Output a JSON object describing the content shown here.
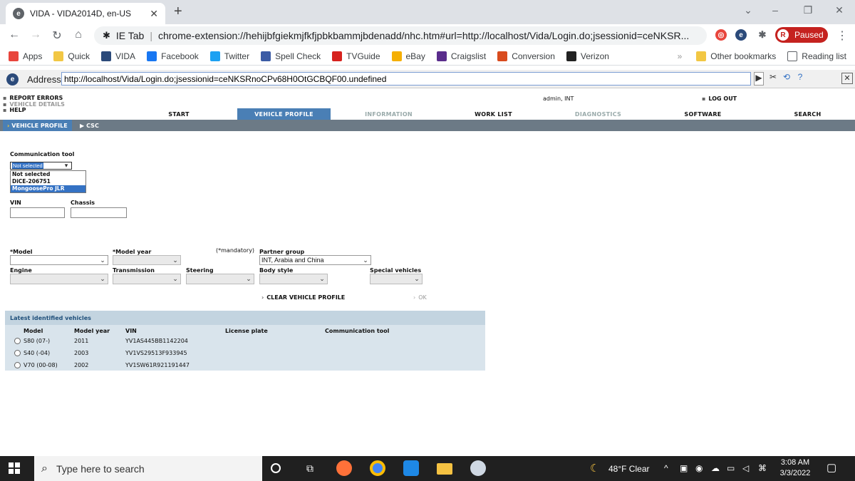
{
  "browser": {
    "tab_title": "VIDA - VIDA2014D, en-US",
    "tab_close": "✕",
    "new_tab": "+",
    "url_prefix": "IE Tab",
    "url": "chrome-extension://hehijbfgiekmjfkfjpbkbammjbdenadd/nhc.htm#url=http://localhost/Vida/Login.do;jsessionid=ceNKSR...",
    "profile_status": "Paused",
    "profile_initial": "R"
  },
  "bookmarks": {
    "items": [
      {
        "label": "Apps",
        "icon": "apps-grid-icon",
        "color": "#e8453c"
      },
      {
        "label": "Quick",
        "icon": "folder-icon",
        "color": "#f2c744"
      },
      {
        "label": "VIDA",
        "icon": "ie-tab-icon",
        "color": "#2b4a7a"
      },
      {
        "label": "Facebook",
        "icon": "facebook-icon",
        "color": "#1877f2"
      },
      {
        "label": "Twitter",
        "icon": "twitter-icon",
        "color": "#1da1f2"
      },
      {
        "label": "Spell Check",
        "icon": "shield-check-icon",
        "color": "#3b5ba5"
      },
      {
        "label": "TVGuide",
        "icon": "tvguide-icon",
        "color": "#d6221e"
      },
      {
        "label": "eBay",
        "icon": "shopping-bag-icon",
        "color": "#f5af02"
      },
      {
        "label": "Craigslist",
        "icon": "peace-icon",
        "color": "#5a2d8c"
      },
      {
        "label": "Conversion",
        "icon": "conversion-icon",
        "color": "#d94b1e"
      },
      {
        "label": "Verizon",
        "icon": "verizon-icon",
        "color": "#222222"
      }
    ],
    "other": "Other bookmarks",
    "reading": "Reading list",
    "overflow": "»"
  },
  "ietab": {
    "address_label": "Address:",
    "address_value": "http://localhost/Vida/Login.do;jsessionid=ceNKSRnoCPv68H0OtGCBQF00.undefined",
    "close": "✕"
  },
  "vida": {
    "side_links": [
      "REPORT ERRORS",
      "VEHICLE DETAILS",
      "HELP"
    ],
    "user": "admin, INT",
    "logout": "LOG OUT",
    "menu": [
      "START",
      "VEHICLE PROFILE",
      "INFORMATION",
      "WORK LIST",
      "DIAGNOSTICS",
      "SOFTWARE",
      "SEARCH"
    ],
    "submenu": [
      "VEHICLE PROFILE",
      "CSC"
    ],
    "comm_tool_label": "Communication tool",
    "comm_tool_selected": "Not selected",
    "comm_tool_options": [
      "Not selected",
      "DiCE-206751",
      "MongoosePro JLR"
    ],
    "vin_label": "VIN",
    "chassis_label": "Chassis",
    "mandatory_note": "(*mandatory)",
    "model_label": "*Model",
    "model_year_label": "*Model year",
    "partner_group_label": "Partner group",
    "partner_group_value": "INT, Arabia and China",
    "engine_label": "Engine",
    "transmission_label": "Transmission",
    "steering_label": "Steering",
    "body_style_label": "Body style",
    "special_vehicles_label": "Special vehicles",
    "clear_profile": "CLEAR VEHICLE PROFILE",
    "ok": "OK",
    "latest": {
      "title": "Latest identified vehicles",
      "headers": [
        "Model",
        "Model year",
        "VIN",
        "License plate",
        "Communication tool"
      ],
      "rows": [
        {
          "model": "S80 (07-)",
          "year": "2011",
          "vin": "YV1AS445BB1142204"
        },
        {
          "model": "S40 (-04)",
          "year": "2003",
          "vin": "YV1VS29513F933945"
        },
        {
          "model": "V70 (00-08)",
          "year": "2002",
          "vin": "YV1SW61R921191447"
        }
      ]
    }
  },
  "taskbar": {
    "search_placeholder": "Type here to search",
    "weather": "48°F  Clear",
    "time": "3:08 AM",
    "date": "3/3/2022"
  }
}
